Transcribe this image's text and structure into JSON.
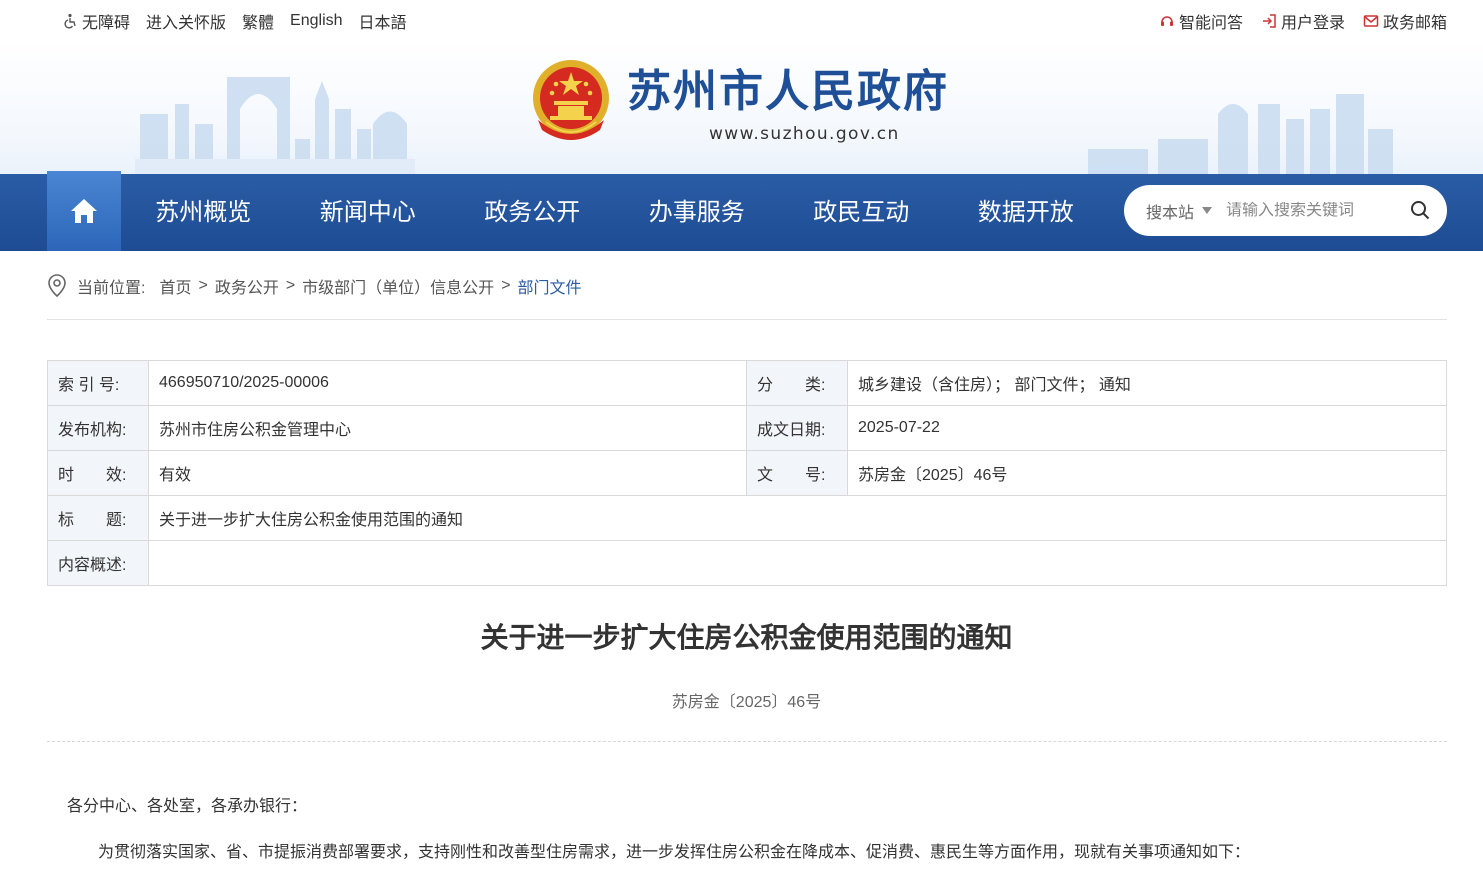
{
  "topbar": {
    "left": [
      "无障碍",
      "进入关怀版",
      "繁體",
      "English",
      "日本語"
    ],
    "right": [
      "智能问答",
      "用户登录",
      "政务邮箱"
    ]
  },
  "header": {
    "title": "苏州市人民政府",
    "url": "www.suzhou.gov.cn"
  },
  "nav": {
    "items": [
      "苏州概览",
      "新闻中心",
      "政务公开",
      "办事服务",
      "政民互动",
      "数据开放"
    ],
    "search_scope": "搜本站",
    "search_placeholder": "请输入搜索关键词"
  },
  "breadcrumb": {
    "label": "当前位置:",
    "items": [
      "首页",
      "政务公开",
      "市级部门（单位）信息公开",
      "部门文件"
    ],
    "sep": ">"
  },
  "info": {
    "index_label": "索 引 号:",
    "index_value": "466950710/2025-00006",
    "category_label": "分　　类:",
    "category_value": "城乡建设（含住房）； 部门文件； 通知",
    "publisher_label": "发布机构:",
    "publisher_value": "苏州市住房公积金管理中心",
    "date_label": "成文日期:",
    "date_value": "2025-07-22",
    "validity_label": "时　　效:",
    "validity_value": "有效",
    "docno_label": "文　　号:",
    "docno_value": "苏房金〔2025〕46号",
    "subject_label": "标　　题:",
    "subject_value": "关于进一步扩大住房公积金使用范围的通知",
    "summary_label": "内容概述:",
    "summary_value": ""
  },
  "article": {
    "title": "关于进一步扩大住房公积金使用范围的通知",
    "doc_no": "苏房金〔2025〕46号",
    "salutation": "各分中心、各处室，各承办银行：",
    "para1": "为贯彻落实国家、省、市提振消费部署要求，支持刚性和改善型住房需求，进一步发挥住房公积金在降成本、促消费、惠民生等方面作用，现就有关事项通知如下："
  },
  "colors": {
    "nav": "#2a5ca5",
    "brand": "#1f4f96",
    "home": "#3a76c6"
  }
}
